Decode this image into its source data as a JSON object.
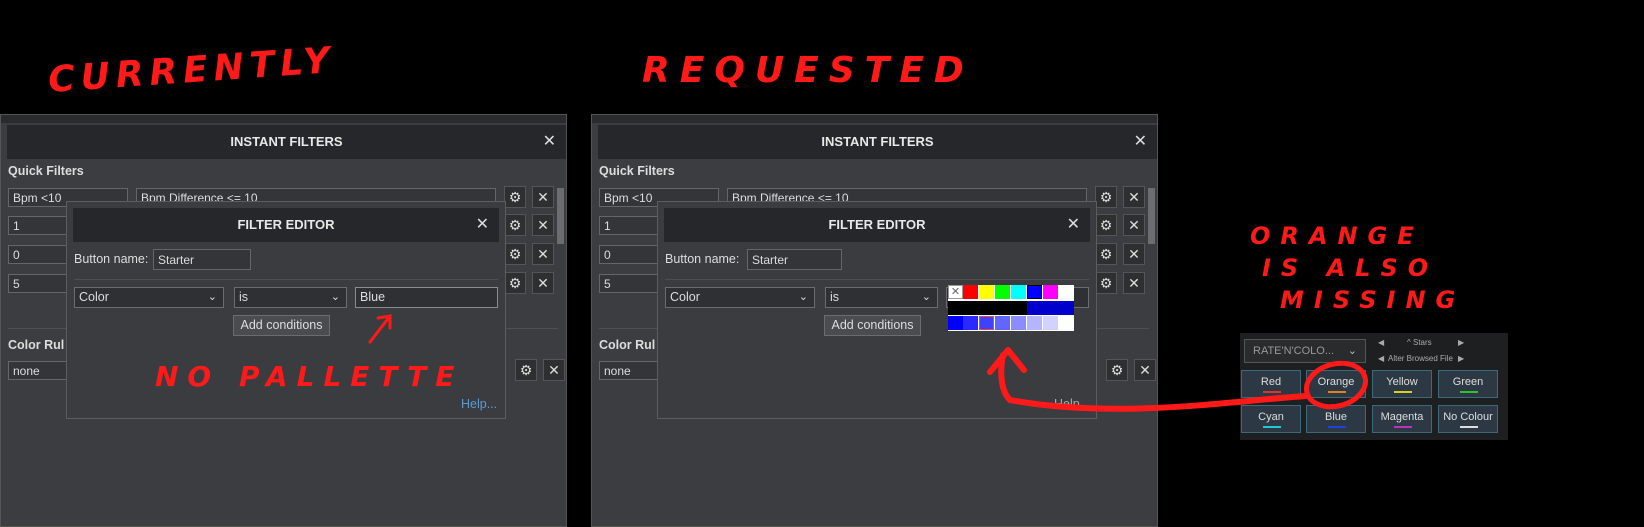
{
  "annotations": {
    "currently": "CURRENTLY",
    "requested": "REQUESTED",
    "no_palette": "NO PALLETTE",
    "orange_missing": [
      "ORANGE",
      "IS ALSO",
      "MISSING"
    ]
  },
  "left_panel": {
    "title": "INSTANT FILTERS",
    "quick_filters_label": "Quick Filters",
    "rows": [
      "Bpm <10",
      "1",
      "0",
      "5"
    ],
    "row0_condition": "Bpm Difference <= 10",
    "color_rules_label": "Color Rul",
    "color_rules_value": "none",
    "dialog": {
      "title": "FILTER EDITOR",
      "button_name_label": "Button name:",
      "button_name_value": "Starter",
      "field_select": "Color",
      "operator_select": "is",
      "value_input": "Blue",
      "add_conditions": "Add conditions",
      "help": "Help..."
    }
  },
  "right_panel": {
    "title": "INSTANT FILTERS",
    "quick_filters_label": "Quick Filters",
    "rows": [
      "Bpm <10",
      "1",
      "0",
      "5"
    ],
    "row0_condition": "Bpm Difference <= 10",
    "color_rules_label": "Color Rul",
    "color_rules_value": "none",
    "dialog": {
      "title": "FILTER EDITOR",
      "button_name_label": "Button name:",
      "button_name_value": "Starter",
      "field_select": "Color",
      "operator_select": "is",
      "add_conditions": "Add conditions",
      "help_partial": "Help"
    },
    "palette_row1": [
      "#ffffff",
      "#ff0000",
      "#ffff00",
      "#00ff00",
      "#00ffff",
      "#0000ff",
      "#ff00ff",
      "#ffffff"
    ],
    "palette_row2": [
      "#000000",
      "#000000",
      "#000000",
      "#000000",
      "#000000",
      "#0000cc",
      "#0000cc",
      "#0000cc"
    ],
    "palette_row3": [
      "#0000ff",
      "#2a2aff",
      "#4040ff",
      "#6464ff",
      "#8c8cff",
      "#b4b4ff",
      "#d2d2ff",
      "#ffffff"
    ]
  },
  "widget": {
    "dropdown": "RATE'N'COLO...",
    "stars_label": "^ Stars",
    "alter_label": "Alter Browsed File",
    "buttons": [
      {
        "label": "Red",
        "color": "#e03030"
      },
      {
        "label": "Orange",
        "color": "#e08020"
      },
      {
        "label": "Yellow",
        "color": "#d8d020"
      },
      {
        "label": "Green",
        "color": "#30c030"
      },
      {
        "label": "Cyan",
        "color": "#20c8d0"
      },
      {
        "label": "Blue",
        "color": "#2040e0"
      },
      {
        "label": "Magenta",
        "color": "#c030c0"
      },
      {
        "label": "No Colour",
        "color": "#dddddd"
      }
    ]
  }
}
